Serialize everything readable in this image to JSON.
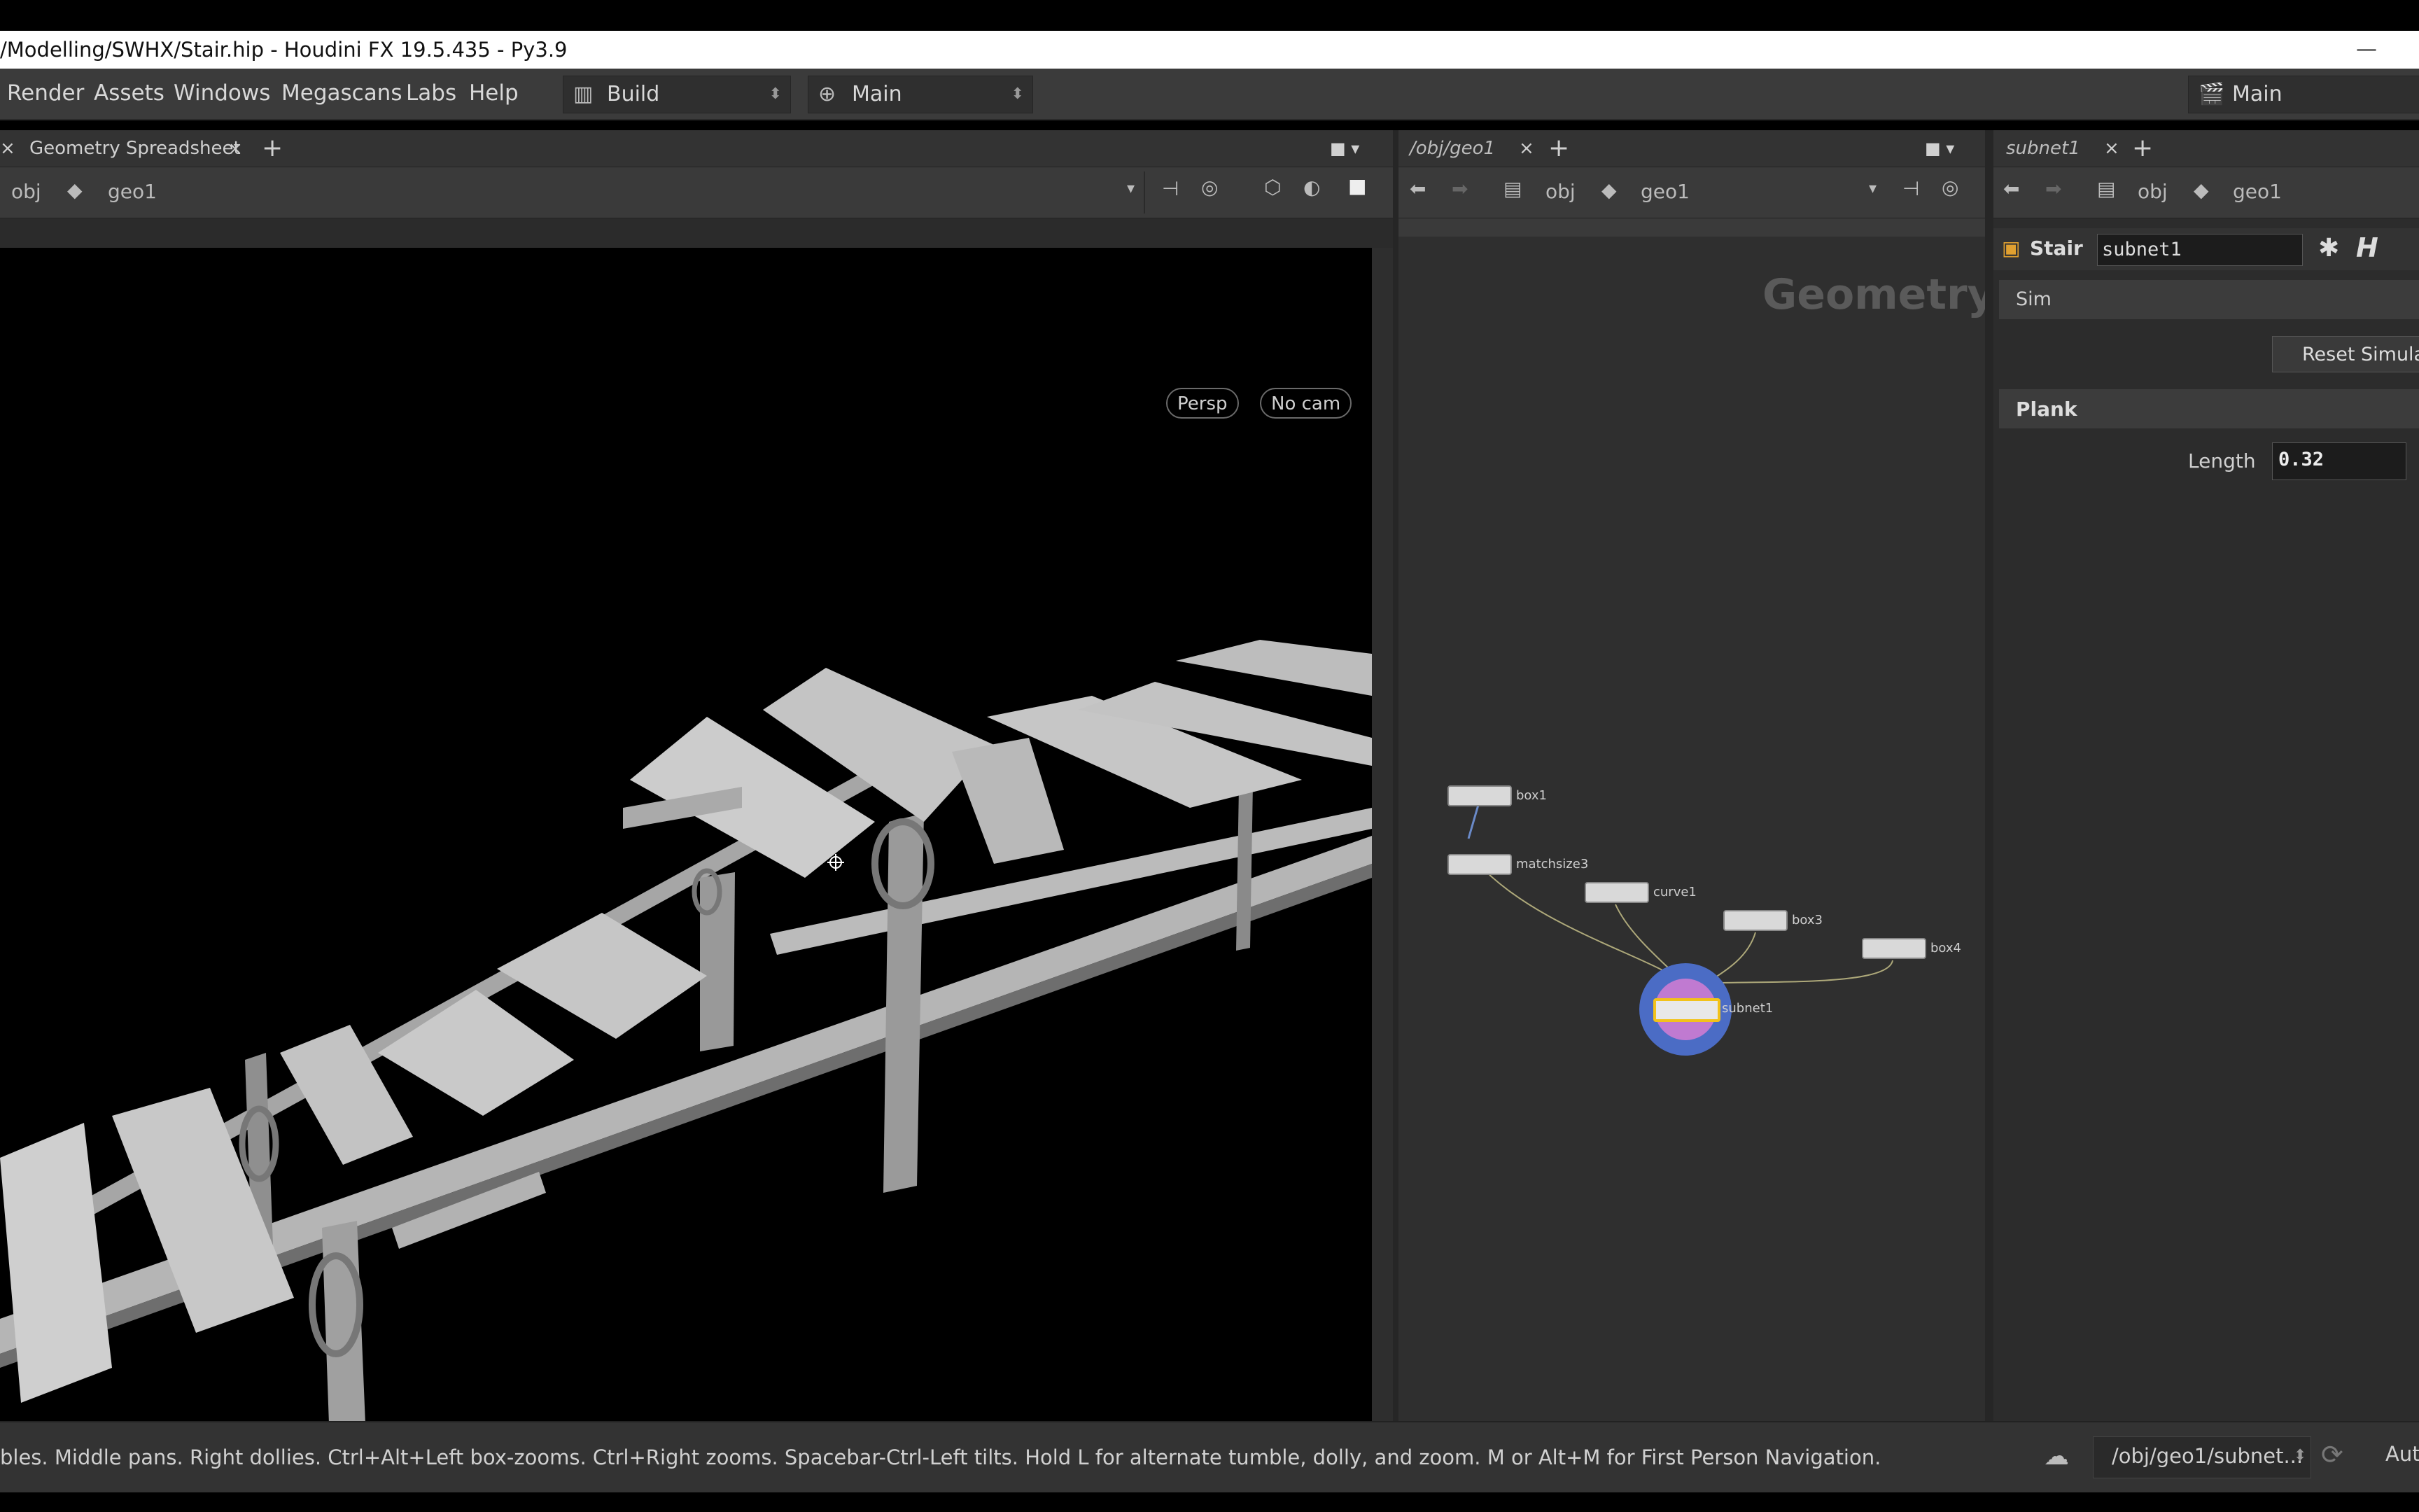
{
  "window": {
    "title": "/Modelling/SWHX/Stair.hip - Houdini FX 19.5.435 - Py3.9",
    "minimize": "—"
  },
  "menu": {
    "items": [
      "Render",
      "Assets",
      "Windows",
      "Megascans",
      "Labs",
      "Help"
    ],
    "desktop_combo": "Build",
    "shelf_combo": "Main",
    "right_combo": "Main"
  },
  "left_pane": {
    "tab_close": "×",
    "tab_label": "Geometry Spreadsheet",
    "add": "+",
    "path": {
      "root": "obj",
      "node": "geo1"
    },
    "viewport": {
      "persp": "Persp",
      "cam": "No cam"
    }
  },
  "network_pane": {
    "tab_label": "/obj/geo1",
    "tab_close": "×",
    "add": "+",
    "path": {
      "root": "obj",
      "node": "geo1"
    },
    "context_label": "Geometry",
    "nodes": [
      {
        "id": "box1",
        "label": "box1"
      },
      {
        "id": "matchsize3",
        "label": "matchsize3"
      },
      {
        "id": "curve1",
        "label": "curve1"
      },
      {
        "id": "box3",
        "label": "box3"
      },
      {
        "id": "box4",
        "label": "box4"
      },
      {
        "id": "subnet1",
        "label": "subnet1"
      }
    ]
  },
  "param_pane": {
    "tab_label": "subnet1",
    "tab_close": "×",
    "add": "+",
    "path": {
      "root": "obj",
      "node": "geo1"
    },
    "node_type": "Stair",
    "node_name": "subnet1",
    "folder_sim": "Sim",
    "reset_button": "Reset Simulat",
    "folder_plank": "Plank",
    "length_label": "Length",
    "length_value": "0.32"
  },
  "status": {
    "message": "bles. Middle pans. Right dollies. Ctrl+Alt+Left box-zooms. Ctrl+Right zooms. Spacebar-Ctrl-Left tilts. Hold L for alternate tumble, dolly, and zoom.     M or Alt+M for First Person Navigation.",
    "path": "/obj/geo1/subnet...",
    "auto": "Aut"
  }
}
